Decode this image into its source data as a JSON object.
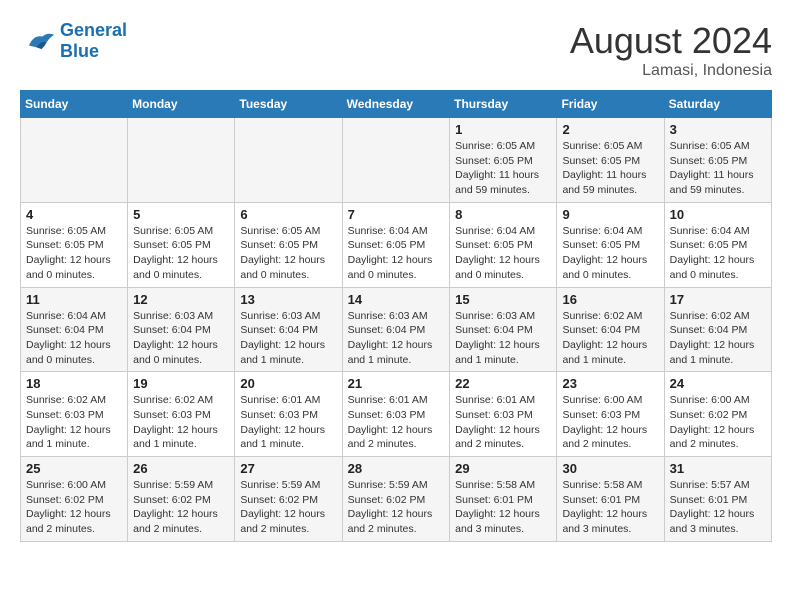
{
  "header": {
    "logo_line1": "General",
    "logo_line2": "Blue",
    "month": "August 2024",
    "location": "Lamasi, Indonesia"
  },
  "weekdays": [
    "Sunday",
    "Monday",
    "Tuesday",
    "Wednesday",
    "Thursday",
    "Friday",
    "Saturday"
  ],
  "weeks": [
    [
      {
        "day": "",
        "info": ""
      },
      {
        "day": "",
        "info": ""
      },
      {
        "day": "",
        "info": ""
      },
      {
        "day": "",
        "info": ""
      },
      {
        "day": "1",
        "info": "Sunrise: 6:05 AM\nSunset: 6:05 PM\nDaylight: 11 hours\nand 59 minutes."
      },
      {
        "day": "2",
        "info": "Sunrise: 6:05 AM\nSunset: 6:05 PM\nDaylight: 11 hours\nand 59 minutes."
      },
      {
        "day": "3",
        "info": "Sunrise: 6:05 AM\nSunset: 6:05 PM\nDaylight: 11 hours\nand 59 minutes."
      }
    ],
    [
      {
        "day": "4",
        "info": "Sunrise: 6:05 AM\nSunset: 6:05 PM\nDaylight: 12 hours\nand 0 minutes."
      },
      {
        "day": "5",
        "info": "Sunrise: 6:05 AM\nSunset: 6:05 PM\nDaylight: 12 hours\nand 0 minutes."
      },
      {
        "day": "6",
        "info": "Sunrise: 6:05 AM\nSunset: 6:05 PM\nDaylight: 12 hours\nand 0 minutes."
      },
      {
        "day": "7",
        "info": "Sunrise: 6:04 AM\nSunset: 6:05 PM\nDaylight: 12 hours\nand 0 minutes."
      },
      {
        "day": "8",
        "info": "Sunrise: 6:04 AM\nSunset: 6:05 PM\nDaylight: 12 hours\nand 0 minutes."
      },
      {
        "day": "9",
        "info": "Sunrise: 6:04 AM\nSunset: 6:05 PM\nDaylight: 12 hours\nand 0 minutes."
      },
      {
        "day": "10",
        "info": "Sunrise: 6:04 AM\nSunset: 6:05 PM\nDaylight: 12 hours\nand 0 minutes."
      }
    ],
    [
      {
        "day": "11",
        "info": "Sunrise: 6:04 AM\nSunset: 6:04 PM\nDaylight: 12 hours\nand 0 minutes."
      },
      {
        "day": "12",
        "info": "Sunrise: 6:03 AM\nSunset: 6:04 PM\nDaylight: 12 hours\nand 0 minutes."
      },
      {
        "day": "13",
        "info": "Sunrise: 6:03 AM\nSunset: 6:04 PM\nDaylight: 12 hours\nand 1 minute."
      },
      {
        "day": "14",
        "info": "Sunrise: 6:03 AM\nSunset: 6:04 PM\nDaylight: 12 hours\nand 1 minute."
      },
      {
        "day": "15",
        "info": "Sunrise: 6:03 AM\nSunset: 6:04 PM\nDaylight: 12 hours\nand 1 minute."
      },
      {
        "day": "16",
        "info": "Sunrise: 6:02 AM\nSunset: 6:04 PM\nDaylight: 12 hours\nand 1 minute."
      },
      {
        "day": "17",
        "info": "Sunrise: 6:02 AM\nSunset: 6:04 PM\nDaylight: 12 hours\nand 1 minute."
      }
    ],
    [
      {
        "day": "18",
        "info": "Sunrise: 6:02 AM\nSunset: 6:03 PM\nDaylight: 12 hours\nand 1 minute."
      },
      {
        "day": "19",
        "info": "Sunrise: 6:02 AM\nSunset: 6:03 PM\nDaylight: 12 hours\nand 1 minute."
      },
      {
        "day": "20",
        "info": "Sunrise: 6:01 AM\nSunset: 6:03 PM\nDaylight: 12 hours\nand 1 minute."
      },
      {
        "day": "21",
        "info": "Sunrise: 6:01 AM\nSunset: 6:03 PM\nDaylight: 12 hours\nand 2 minutes."
      },
      {
        "day": "22",
        "info": "Sunrise: 6:01 AM\nSunset: 6:03 PM\nDaylight: 12 hours\nand 2 minutes."
      },
      {
        "day": "23",
        "info": "Sunrise: 6:00 AM\nSunset: 6:03 PM\nDaylight: 12 hours\nand 2 minutes."
      },
      {
        "day": "24",
        "info": "Sunrise: 6:00 AM\nSunset: 6:02 PM\nDaylight: 12 hours\nand 2 minutes."
      }
    ],
    [
      {
        "day": "25",
        "info": "Sunrise: 6:00 AM\nSunset: 6:02 PM\nDaylight: 12 hours\nand 2 minutes."
      },
      {
        "day": "26",
        "info": "Sunrise: 5:59 AM\nSunset: 6:02 PM\nDaylight: 12 hours\nand 2 minutes."
      },
      {
        "day": "27",
        "info": "Sunrise: 5:59 AM\nSunset: 6:02 PM\nDaylight: 12 hours\nand 2 minutes."
      },
      {
        "day": "28",
        "info": "Sunrise: 5:59 AM\nSunset: 6:02 PM\nDaylight: 12 hours\nand 2 minutes."
      },
      {
        "day": "29",
        "info": "Sunrise: 5:58 AM\nSunset: 6:01 PM\nDaylight: 12 hours\nand 3 minutes."
      },
      {
        "day": "30",
        "info": "Sunrise: 5:58 AM\nSunset: 6:01 PM\nDaylight: 12 hours\nand 3 minutes."
      },
      {
        "day": "31",
        "info": "Sunrise: 5:57 AM\nSunset: 6:01 PM\nDaylight: 12 hours\nand 3 minutes."
      }
    ]
  ]
}
